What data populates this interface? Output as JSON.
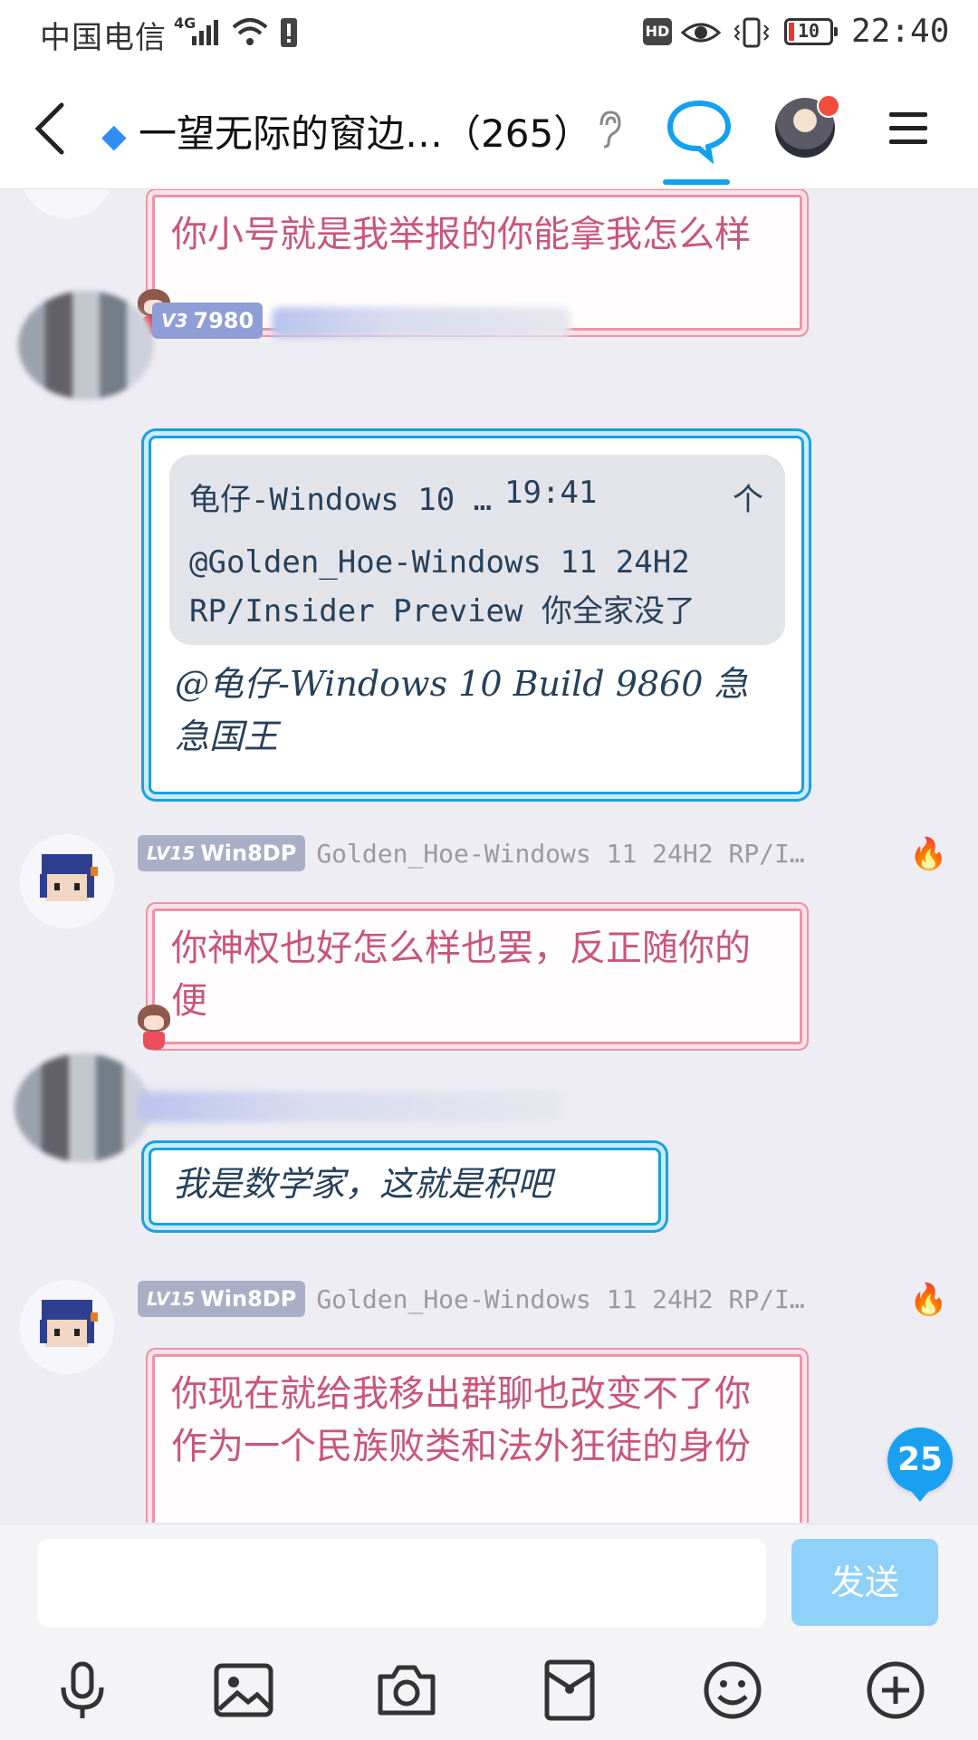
{
  "status_bar": {
    "carrier": "中国电信",
    "network": "4G",
    "hd": "HD",
    "battery": "10",
    "time": "22:40"
  },
  "header": {
    "title": "一望无际的窗边…（265）",
    "back_icon": "back-arrow-icon",
    "tab_icon": "chat-bubble-icon",
    "menu_icon": "hamburger-menu-icon"
  },
  "messages": [
    {
      "type": "pink",
      "text": "你小号就是我举报的你能拿我怎么样"
    },
    {
      "type": "blue",
      "level": "V3",
      "level_value": "7980",
      "quote_author": "龟仔-Windows 10 …",
      "quote_time": "19:41",
      "quote_arrow": "个",
      "quote_text": "@Golden_Hoe-Windows 11 24H2 RP/Insider Preview 你全家没了",
      "text": "@龟仔-Windows 10 Build 9860 急急国王"
    },
    {
      "type": "pink",
      "level": "LV15",
      "title": "Win8DP",
      "nick": "Golden_Hoe-Windows 11 24H2 RP/I…",
      "text": "你神权也好怎么样也罢，反正随你的便"
    },
    {
      "type": "blue",
      "text": "我是数学家，这就是积吧"
    },
    {
      "type": "pink",
      "level": "LV15",
      "title": "Win8DP",
      "nick": "Golden_Hoe-Windows 11 24H2 RP/I…",
      "text": "你现在就给我移出群聊也改变不了你作为一个民族败类和法外狂徒的身份"
    }
  ],
  "unread_count": "25",
  "input": {
    "placeholder": "",
    "send_label": "发送"
  },
  "toolbar": [
    "microphone-icon",
    "image-icon",
    "camera-icon",
    "red-packet-icon",
    "emoji-icon",
    "plus-icon"
  ],
  "colors": {
    "accent": "#1aa0f0",
    "pink_text": "#c8567c",
    "pink_border": "#ec94a8",
    "blue_border": "#1aa0e2",
    "send_disabled": "#8fd1f9"
  }
}
